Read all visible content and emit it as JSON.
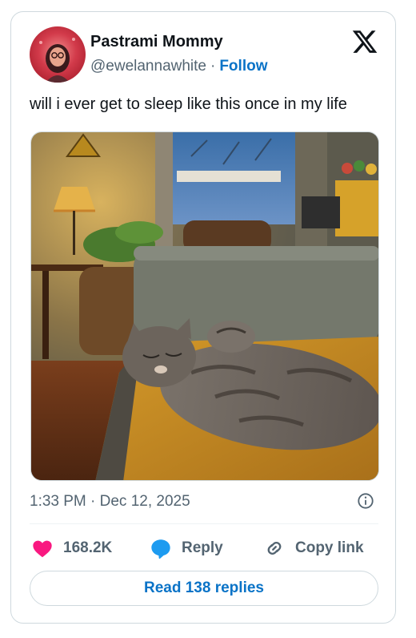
{
  "author": {
    "name": "Pastrami Mommy",
    "handle": "@ewelannawhite",
    "separator": "·",
    "follow_label": "Follow",
    "avatar_icon": "user-avatar"
  },
  "brand": {
    "logo_icon": "x-logo-icon"
  },
  "tweet": {
    "text": "will i ever get to sleep like this once in my life",
    "media_icon": "photo-cat-sleeping-on-couch",
    "timestamp": "1:33 PM · Dec 12, 2025"
  },
  "actions": {
    "like_count": "168.2K",
    "reply_label": "Reply",
    "copy_label": "Copy link"
  },
  "read_replies_label": "Read 138 replies",
  "colors": {
    "heart": "#f91880",
    "reply_bubble": "#1d9bf0",
    "link_blue": "#0a73c7",
    "muted_text": "#536471",
    "border": "#cfd9de"
  }
}
